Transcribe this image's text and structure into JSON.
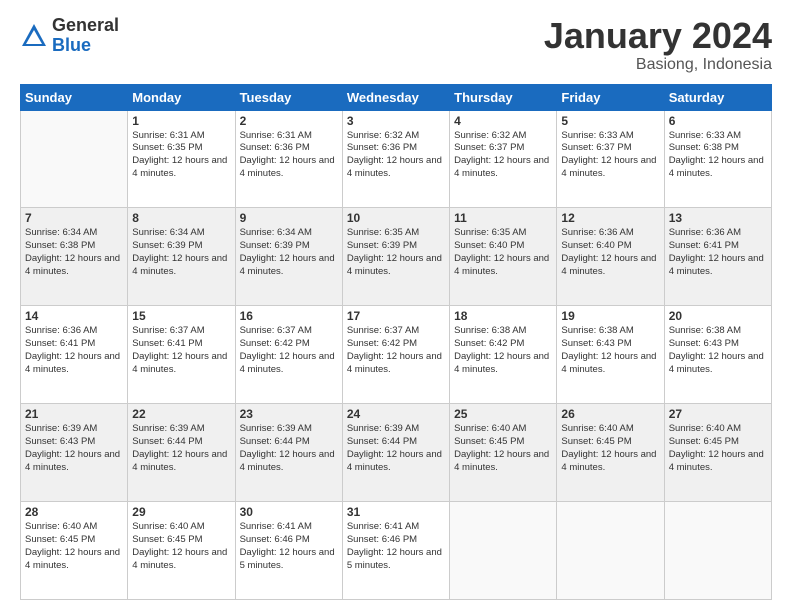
{
  "logo": {
    "general": "General",
    "blue": "Blue"
  },
  "header": {
    "title": "January 2024",
    "subtitle": "Basiong, Indonesia"
  },
  "weekdays": [
    "Sunday",
    "Monday",
    "Tuesday",
    "Wednesday",
    "Thursday",
    "Friday",
    "Saturday"
  ],
  "weeks": [
    [
      {
        "day": "",
        "sunrise": "",
        "sunset": "",
        "daylight": ""
      },
      {
        "day": "1",
        "sunrise": "Sunrise: 6:31 AM",
        "sunset": "Sunset: 6:35 PM",
        "daylight": "Daylight: 12 hours and 4 minutes."
      },
      {
        "day": "2",
        "sunrise": "Sunrise: 6:31 AM",
        "sunset": "Sunset: 6:36 PM",
        "daylight": "Daylight: 12 hours and 4 minutes."
      },
      {
        "day": "3",
        "sunrise": "Sunrise: 6:32 AM",
        "sunset": "Sunset: 6:36 PM",
        "daylight": "Daylight: 12 hours and 4 minutes."
      },
      {
        "day": "4",
        "sunrise": "Sunrise: 6:32 AM",
        "sunset": "Sunset: 6:37 PM",
        "daylight": "Daylight: 12 hours and 4 minutes."
      },
      {
        "day": "5",
        "sunrise": "Sunrise: 6:33 AM",
        "sunset": "Sunset: 6:37 PM",
        "daylight": "Daylight: 12 hours and 4 minutes."
      },
      {
        "day": "6",
        "sunrise": "Sunrise: 6:33 AM",
        "sunset": "Sunset: 6:38 PM",
        "daylight": "Daylight: 12 hours and 4 minutes."
      }
    ],
    [
      {
        "day": "7",
        "sunrise": "Sunrise: 6:34 AM",
        "sunset": "Sunset: 6:38 PM",
        "daylight": "Daylight: 12 hours and 4 minutes."
      },
      {
        "day": "8",
        "sunrise": "Sunrise: 6:34 AM",
        "sunset": "Sunset: 6:39 PM",
        "daylight": "Daylight: 12 hours and 4 minutes."
      },
      {
        "day": "9",
        "sunrise": "Sunrise: 6:34 AM",
        "sunset": "Sunset: 6:39 PM",
        "daylight": "Daylight: 12 hours and 4 minutes."
      },
      {
        "day": "10",
        "sunrise": "Sunrise: 6:35 AM",
        "sunset": "Sunset: 6:39 PM",
        "daylight": "Daylight: 12 hours and 4 minutes."
      },
      {
        "day": "11",
        "sunrise": "Sunrise: 6:35 AM",
        "sunset": "Sunset: 6:40 PM",
        "daylight": "Daylight: 12 hours and 4 minutes."
      },
      {
        "day": "12",
        "sunrise": "Sunrise: 6:36 AM",
        "sunset": "Sunset: 6:40 PM",
        "daylight": "Daylight: 12 hours and 4 minutes."
      },
      {
        "day": "13",
        "sunrise": "Sunrise: 6:36 AM",
        "sunset": "Sunset: 6:41 PM",
        "daylight": "Daylight: 12 hours and 4 minutes."
      }
    ],
    [
      {
        "day": "14",
        "sunrise": "Sunrise: 6:36 AM",
        "sunset": "Sunset: 6:41 PM",
        "daylight": "Daylight: 12 hours and 4 minutes."
      },
      {
        "day": "15",
        "sunrise": "Sunrise: 6:37 AM",
        "sunset": "Sunset: 6:41 PM",
        "daylight": "Daylight: 12 hours and 4 minutes."
      },
      {
        "day": "16",
        "sunrise": "Sunrise: 6:37 AM",
        "sunset": "Sunset: 6:42 PM",
        "daylight": "Daylight: 12 hours and 4 minutes."
      },
      {
        "day": "17",
        "sunrise": "Sunrise: 6:37 AM",
        "sunset": "Sunset: 6:42 PM",
        "daylight": "Daylight: 12 hours and 4 minutes."
      },
      {
        "day": "18",
        "sunrise": "Sunrise: 6:38 AM",
        "sunset": "Sunset: 6:42 PM",
        "daylight": "Daylight: 12 hours and 4 minutes."
      },
      {
        "day": "19",
        "sunrise": "Sunrise: 6:38 AM",
        "sunset": "Sunset: 6:43 PM",
        "daylight": "Daylight: 12 hours and 4 minutes."
      },
      {
        "day": "20",
        "sunrise": "Sunrise: 6:38 AM",
        "sunset": "Sunset: 6:43 PM",
        "daylight": "Daylight: 12 hours and 4 minutes."
      }
    ],
    [
      {
        "day": "21",
        "sunrise": "Sunrise: 6:39 AM",
        "sunset": "Sunset: 6:43 PM",
        "daylight": "Daylight: 12 hours and 4 minutes."
      },
      {
        "day": "22",
        "sunrise": "Sunrise: 6:39 AM",
        "sunset": "Sunset: 6:44 PM",
        "daylight": "Daylight: 12 hours and 4 minutes."
      },
      {
        "day": "23",
        "sunrise": "Sunrise: 6:39 AM",
        "sunset": "Sunset: 6:44 PM",
        "daylight": "Daylight: 12 hours and 4 minutes."
      },
      {
        "day": "24",
        "sunrise": "Sunrise: 6:39 AM",
        "sunset": "Sunset: 6:44 PM",
        "daylight": "Daylight: 12 hours and 4 minutes."
      },
      {
        "day": "25",
        "sunrise": "Sunrise: 6:40 AM",
        "sunset": "Sunset: 6:45 PM",
        "daylight": "Daylight: 12 hours and 4 minutes."
      },
      {
        "day": "26",
        "sunrise": "Sunrise: 6:40 AM",
        "sunset": "Sunset: 6:45 PM",
        "daylight": "Daylight: 12 hours and 4 minutes."
      },
      {
        "day": "27",
        "sunrise": "Sunrise: 6:40 AM",
        "sunset": "Sunset: 6:45 PM",
        "daylight": "Daylight: 12 hours and 4 minutes."
      }
    ],
    [
      {
        "day": "28",
        "sunrise": "Sunrise: 6:40 AM",
        "sunset": "Sunset: 6:45 PM",
        "daylight": "Daylight: 12 hours and 4 minutes."
      },
      {
        "day": "29",
        "sunrise": "Sunrise: 6:40 AM",
        "sunset": "Sunset: 6:45 PM",
        "daylight": "Daylight: 12 hours and 4 minutes."
      },
      {
        "day": "30",
        "sunrise": "Sunrise: 6:41 AM",
        "sunset": "Sunset: 6:46 PM",
        "daylight": "Daylight: 12 hours and 5 minutes."
      },
      {
        "day": "31",
        "sunrise": "Sunrise: 6:41 AM",
        "sunset": "Sunset: 6:46 PM",
        "daylight": "Daylight: 12 hours and 5 minutes."
      },
      {
        "day": "",
        "sunrise": "",
        "sunset": "",
        "daylight": ""
      },
      {
        "day": "",
        "sunrise": "",
        "sunset": "",
        "daylight": ""
      },
      {
        "day": "",
        "sunrise": "",
        "sunset": "",
        "daylight": ""
      }
    ]
  ]
}
